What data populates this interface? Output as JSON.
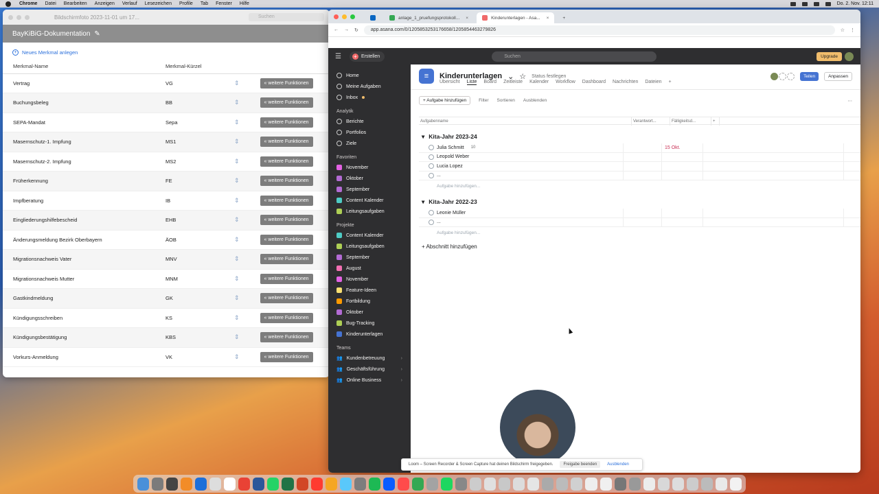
{
  "menubar": {
    "app": "Chrome",
    "items": [
      "Datei",
      "Bearbeiten",
      "Anzeigen",
      "Verlauf",
      "Lesezeichen",
      "Profile",
      "Tab",
      "Fenster",
      "Hilfe"
    ],
    "clock": "Do. 2. Nov.  12:11"
  },
  "leftwin": {
    "title": "Bildschirmfoto 2023-11-01 um 17...",
    "search": "Suchen",
    "header": "BayKiBiG-Dokumentation",
    "add_label": "Neues Merkmal anlegen",
    "col_name": "Merkmal-Name",
    "col_short": "Merkmal-Kürzel",
    "button_label": "« weitere Funktionen",
    "rows": [
      {
        "name": "Vertrag",
        "short": "VG"
      },
      {
        "name": "Buchungsbeleg",
        "short": "BB"
      },
      {
        "name": "SEPA-Mandat",
        "short": "Sepa"
      },
      {
        "name": "Masernschutz-1. Impfung",
        "short": "MS1"
      },
      {
        "name": "Masernschutz-2. Impfung",
        "short": "MS2"
      },
      {
        "name": "Früherkennung",
        "short": "FE"
      },
      {
        "name": "Impfberatung",
        "short": "IB"
      },
      {
        "name": "Eingliederungshilfebescheid",
        "short": "EHB"
      },
      {
        "name": "Änderungsmeldung Bezirk Oberbayern",
        "short": "ÄOB"
      },
      {
        "name": "Migrationsnachweis Vater",
        "short": "MNV"
      },
      {
        "name": "Migrationsnachweis Mutter",
        "short": "MNM"
      },
      {
        "name": "Gastkindmeldung",
        "short": "GK"
      },
      {
        "name": "Kündigungsschreiben",
        "short": "KS"
      },
      {
        "name": "Kündigungsbestätigung",
        "short": "KBS"
      },
      {
        "name": "Vorkurs-Anmeldung",
        "short": "VK"
      }
    ]
  },
  "browser": {
    "tabs": [
      "anlage_1_pruefungsprotokoll...",
      "Kinderunterlagen - Asa..."
    ],
    "url": "app.asana.com/0/1205853253176658/1205854463279826"
  },
  "asana": {
    "create": "Erstellen",
    "search": "Suchen",
    "upgrade": "Upgrade",
    "nav": {
      "home": "Home",
      "mytasks": "Meine Aufgaben",
      "inbox": "Inbox",
      "analytics_label": "Analytik",
      "reports": "Berichte",
      "portfolios": "Portfolios",
      "goals": "Ziele",
      "favorites_label": "Favoriten",
      "favorites": [
        {
          "label": "November",
          "color": "#e362e3"
        },
        {
          "label": "Oktober",
          "color": "#b36bd4"
        },
        {
          "label": "September",
          "color": "#b36bd4"
        },
        {
          "label": "Content Kalender",
          "color": "#4ecbc4"
        },
        {
          "label": "Leitungsaufgaben",
          "color": "#aecf55"
        }
      ],
      "projects_label": "Projekte",
      "projects": [
        {
          "label": "Content Kalender",
          "color": "#4ecbc4"
        },
        {
          "label": "Leitungsaufgaben",
          "color": "#aecf55"
        },
        {
          "label": "September",
          "color": "#b36bd4"
        },
        {
          "label": "August",
          "color": "#f26fb2"
        },
        {
          "label": "November",
          "color": "#e362e3"
        },
        {
          "label": "Feature-Ideen",
          "color": "#f8df72"
        },
        {
          "label": "Fortbildung",
          "color": "#fd9a00"
        },
        {
          "label": "Oktober",
          "color": "#b36bd4"
        },
        {
          "label": "Bug-Tracking",
          "color": "#aecf55"
        },
        {
          "label": "Kinderunterlagen",
          "color": "#4573d2"
        }
      ],
      "teams_label": "Teams",
      "teams": [
        "Kundenbetreuung",
        "Geschäftsführung",
        "Online Business"
      ]
    },
    "project": {
      "title": "Kinderunterlagen",
      "status": "Status festlegen",
      "share": "Teilen",
      "customize": "Anpassen",
      "tabs": [
        "Übersicht",
        "Liste",
        "Board",
        "Zeitleiste",
        "Kalender",
        "Workflow",
        "Dashboard",
        "Nachrichten",
        "Dateien"
      ],
      "toolbar": {
        "add_task": "+ Aufgabe hinzufügen",
        "filter": "Filter",
        "sort": "Sortieren",
        "hide": "Ausblenden"
      },
      "columns": {
        "name": "Aufgabenname",
        "assignee": "Verantwort...",
        "due": "Fälligkeitsd..."
      },
      "sections": [
        {
          "title": "Kita-Jahr 2023-24",
          "tasks": [
            {
              "name": "Julia Schmitt",
              "subtasks": "10",
              "due": "15 Okt."
            },
            {
              "name": "Leopold Weber",
              "subtasks": "",
              "due": ""
            },
            {
              "name": "Lucia Lopez",
              "subtasks": "",
              "due": ""
            },
            {
              "name": "...",
              "subtasks": "",
              "due": ""
            }
          ]
        },
        {
          "title": "Kita-Jahr 2022-23",
          "tasks": [
            {
              "name": "Leonie Müller",
              "subtasks": "",
              "due": ""
            },
            {
              "name": "...",
              "subtasks": "",
              "due": ""
            }
          ]
        }
      ],
      "add_task_inline": "Aufgabe hinzufügen...",
      "add_section": "Abschnitt hinzufügen"
    }
  },
  "loom": {
    "text": "Loom – Screen Recorder & Screen Capture hat deinen Bildschirm freigegeben.",
    "stop": "Freigabe beenden",
    "hide": "Ausblenden"
  }
}
